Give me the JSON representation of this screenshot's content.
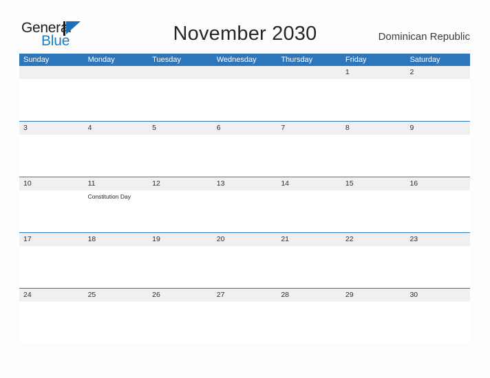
{
  "brand": {
    "name_part1": "General",
    "name_part2": "Blue",
    "flag_icon": "blue-triangle-flag",
    "color_dark": "#1c1c1c",
    "color_blue": "#1d7cc4"
  },
  "header": {
    "title": "November 2030",
    "country": "Dominican Republic"
  },
  "theme": {
    "header_blue": "#2e76bc",
    "row_band_gray": "#f0f0f0",
    "page_background": "#fdfdfd",
    "text_dark": "#2b2b2b"
  },
  "calendar": {
    "month": "November",
    "year": "2030",
    "weekday_headers": [
      "Sunday",
      "Monday",
      "Tuesday",
      "Wednesday",
      "Thursday",
      "Friday",
      "Saturday"
    ],
    "weeks": [
      [
        {
          "day": "",
          "event": ""
        },
        {
          "day": "",
          "event": ""
        },
        {
          "day": "",
          "event": ""
        },
        {
          "day": "",
          "event": ""
        },
        {
          "day": "",
          "event": ""
        },
        {
          "day": "1",
          "event": ""
        },
        {
          "day": "2",
          "event": ""
        }
      ],
      [
        {
          "day": "3",
          "event": ""
        },
        {
          "day": "4",
          "event": ""
        },
        {
          "day": "5",
          "event": ""
        },
        {
          "day": "6",
          "event": ""
        },
        {
          "day": "7",
          "event": ""
        },
        {
          "day": "8",
          "event": ""
        },
        {
          "day": "9",
          "event": ""
        }
      ],
      [
        {
          "day": "10",
          "event": ""
        },
        {
          "day": "11",
          "event": "Constitution Day"
        },
        {
          "day": "12",
          "event": ""
        },
        {
          "day": "13",
          "event": ""
        },
        {
          "day": "14",
          "event": ""
        },
        {
          "day": "15",
          "event": ""
        },
        {
          "day": "16",
          "event": ""
        }
      ],
      [
        {
          "day": "17",
          "event": ""
        },
        {
          "day": "18",
          "event": ""
        },
        {
          "day": "19",
          "event": ""
        },
        {
          "day": "20",
          "event": ""
        },
        {
          "day": "21",
          "event": ""
        },
        {
          "day": "22",
          "event": ""
        },
        {
          "day": "23",
          "event": ""
        }
      ],
      [
        {
          "day": "24",
          "event": ""
        },
        {
          "day": "25",
          "event": ""
        },
        {
          "day": "26",
          "event": ""
        },
        {
          "day": "27",
          "event": ""
        },
        {
          "day": "28",
          "event": ""
        },
        {
          "day": "29",
          "event": ""
        },
        {
          "day": "30",
          "event": ""
        }
      ]
    ]
  }
}
